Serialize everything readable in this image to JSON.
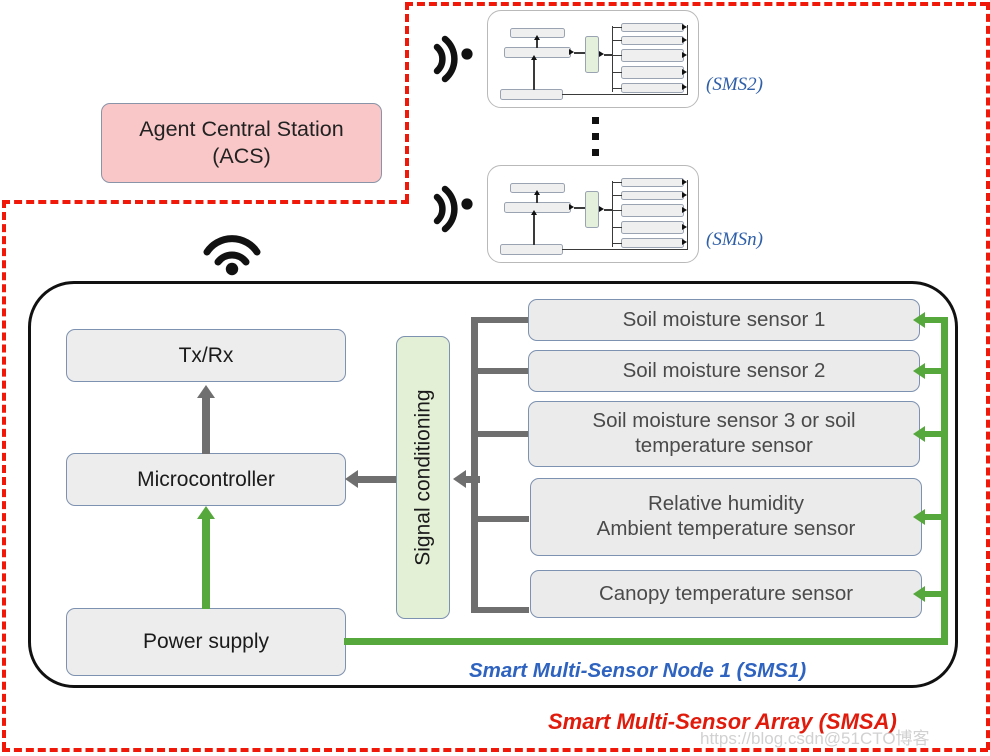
{
  "diagram": {
    "acs": {
      "line1": "Agent Central Station",
      "line2": "(ACS)"
    },
    "node_label": "Smart Multi-Sensor Node 1 (SMS1)",
    "array_label": "Smart Multi-Sensor Array (SMSA)",
    "watermark": "https://blog.csdn@51CTO博客",
    "remote_nodes": [
      {
        "label": "(SMS2)",
        "icon": "antenna-icon"
      },
      {
        "label": "(SMSn)",
        "icon": "antenna-icon"
      }
    ],
    "ellipsis": "vertical-ellipsis",
    "wifi_icon": "wifi-icon",
    "blocks": {
      "txrx": "Tx/Rx",
      "microcontroller": "Microcontroller",
      "power_supply": "Power supply",
      "signal_conditioning": "Signal conditioning"
    },
    "sensors": [
      {
        "lines": [
          "Soil moisture sensor 1"
        ]
      },
      {
        "lines": [
          "Soil moisture sensor 2"
        ]
      },
      {
        "lines": [
          "Soil moisture sensor 3 or soil",
          "temperature sensor"
        ]
      },
      {
        "lines": [
          "Relative humidity",
          "Ambient temperature sensor"
        ]
      },
      {
        "lines": [
          "Canopy temperature sensor"
        ]
      }
    ],
    "colors": {
      "acs_fill": "#f9c7c7",
      "boundary": "#f01808",
      "block_fill": "#ededed",
      "green_fill": "#e3f0d6",
      "signal_arrow": "#6f6f6f",
      "power_arrow": "#56a83c",
      "node_label": "#2f63c0",
      "array_label": "#e11b0c"
    }
  }
}
